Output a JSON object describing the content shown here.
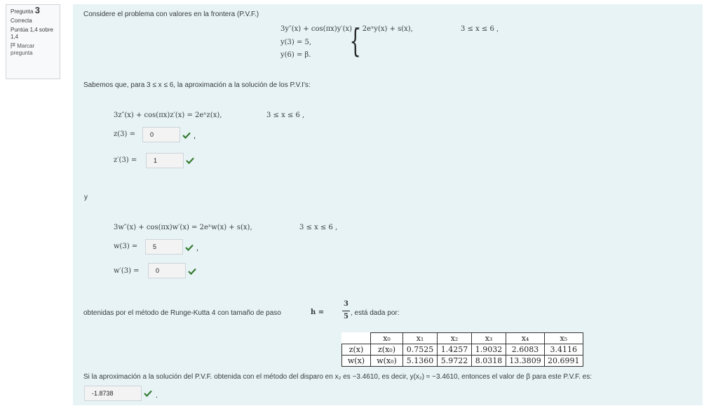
{
  "info": {
    "pregunta_label": "Pregunta",
    "number": "3",
    "status": "Correcta",
    "score": "Puntúa 1,4 sobre 1,4",
    "flag_label": "Marcar pregunta"
  },
  "intro": "Considere el problema con valores en la frontera (P.V.F.)",
  "system": {
    "eq1": "3y″(x) + cos(πx)y′(x) = 2eˣy(x) + s(x),",
    "domain": "3 ≤ x ≤ 6 ,",
    "eq2": "y(3) = 5,",
    "eq3": "y(6) = β."
  },
  "sabemos": "Sabemos que, para 3 ≤ x ≤ 6, la aproximación a la solución de los P.V.I's:",
  "ivp1": {
    "eq": "3z″(x) + cos(πx)z′(x) = 2eˣz(x),",
    "domain": "3 ≤ x ≤ 6 ,",
    "c1_label": "z(3) =",
    "c1_value": "0",
    "c2_label": "z′(3) =",
    "c2_value": "1"
  },
  "y_word": "y",
  "ivp2": {
    "eq": "3w″(x) + cos(πx)w′(x) = 2eˣw(x) + s(x),",
    "domain": "3 ≤ x ≤ 6 ,",
    "c1_label": "w(3) =",
    "c1_value": "5",
    "c2_label": "w′(3) =",
    "c2_value": "0"
  },
  "obtenidas_before": "obtenidas por el método de Runge-Kutta 4 con tamaño de paso",
  "h_label": "h =",
  "frac_num": "3",
  "frac_den": "5",
  "obtenidas_after": ", está dada por:",
  "table": {
    "header": [
      "",
      "x₀",
      "x₁",
      "x₂",
      "x₃",
      "x₄",
      "x₅"
    ],
    "rows": [
      [
        "z(x)",
        "z(x₀)",
        "0.7525",
        "1.4257",
        "1.9032",
        "2.6083",
        "3.4116"
      ],
      [
        "w(x)",
        "w(x₀)",
        "5.1360",
        "5.9722",
        "8.0318",
        "13.3809",
        "20.6991"
      ]
    ]
  },
  "final_text": "Si la aproximación a la solución del P.V.F. obtenida con el método del disparo en x₂ es −3.4610, es decir, y(x₂) ≈ −3.4610, entonces el valor de β para este P.V.F. es:",
  "answer": "-1.8738",
  "colors": {
    "check": "#357a32",
    "panel": "#e7f3f5"
  },
  "icons": {
    "check": "check-icon",
    "flag": "flag-icon"
  }
}
